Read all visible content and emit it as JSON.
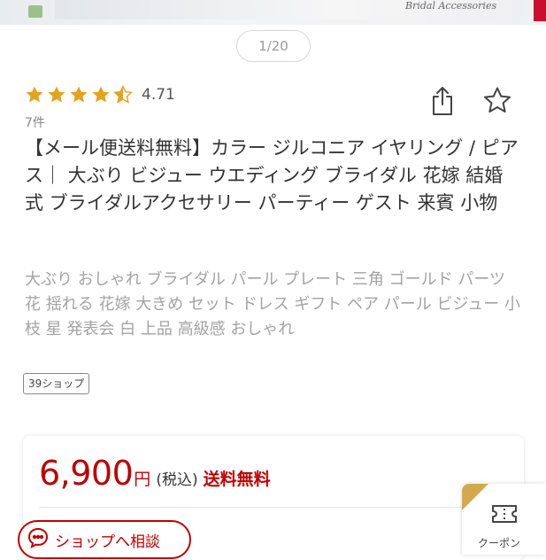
{
  "banner": {
    "caption": "Bridal Accessories"
  },
  "pager": {
    "label": "1/20"
  },
  "rating": {
    "value": "4.71",
    "stars": 4.5,
    "count": "7件",
    "star_color": "#e6a21c"
  },
  "icons": {
    "share": "share-icon",
    "favorite": "star-outline-icon",
    "contact": "chat-icon",
    "coupon": "ticket-icon"
  },
  "product": {
    "title": "【メール便送料無料】カラー ジルコニア イヤリング / ピアス｜ 大ぶり ビジュー ウエディング ブライダル 花嫁 結婚式 ブライダルアクセサリー パーティー ゲスト 来賓 小物",
    "tags": "大ぶり おしゃれ ブライダル パール プレート 三角 ゴールド パーツ 花 揺れる 花嫁 大きめ セット ドレス ギフト ペア パール ビジュー 小枝 星 発表会 白 上品 高級感 おしゃれ",
    "shop_badge": "39ショップ"
  },
  "price": {
    "amount": "6,900",
    "unit": "円",
    "tax": "(税込)",
    "shipping": "送料無料",
    "accent_color": "#bf0000"
  },
  "actions": {
    "contact_shop": "ショップへ相談",
    "coupon": "クーポン"
  }
}
